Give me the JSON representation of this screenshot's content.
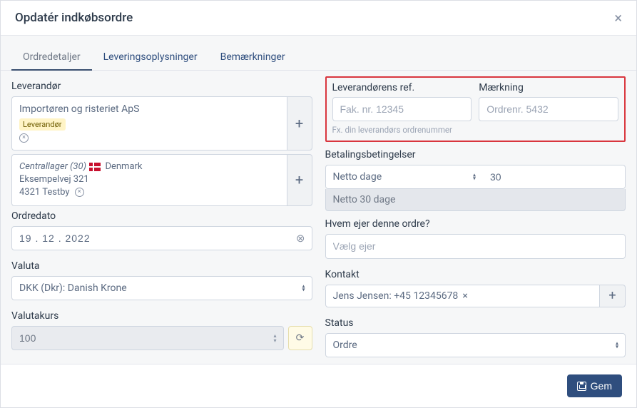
{
  "modal": {
    "title": "Opdatér indkøbsordre",
    "close": "×"
  },
  "tabs": [
    {
      "label": "Ordredetaljer"
    },
    {
      "label": "Leveringsoplysninger"
    },
    {
      "label": "Bemærkninger"
    }
  ],
  "supplier": {
    "label": "Leverandør",
    "name": "Importøren og risteriet ApS",
    "tag": "Leverandør",
    "add": "+"
  },
  "warehouse": {
    "name": "Centrallager (30)",
    "country": "Denmark",
    "line1": "Eksempelvej 321",
    "line2": "4321 Testby",
    "add": "+"
  },
  "order_date": {
    "label": "Ordredato",
    "value": "19 . 12 . 2022"
  },
  "currency": {
    "label": "Valuta",
    "value": "DKK (Dkr): Danish Krone"
  },
  "rate": {
    "label": "Valutakurs",
    "value": "100"
  },
  "supplier_ref": {
    "label": "Leverandørens ref.",
    "placeholder": "Fak. nr. 12345",
    "helper": "Fx. din leverandørs ordrenummer"
  },
  "marking": {
    "label": "Mærkning",
    "placeholder": "Ordrenr. 5432"
  },
  "payment": {
    "label": "Betalingsbetingelser",
    "type": "Netto dage",
    "days": "30",
    "result": "Netto 30 dage"
  },
  "owner": {
    "label": "Hvem ejer denne ordre?",
    "placeholder": "Vælg ejer"
  },
  "contact": {
    "label": "Kontakt",
    "value": "Jens Jensen: +45 12345678",
    "add": "+"
  },
  "status": {
    "label": "Status",
    "value": "Ordre"
  },
  "footer": {
    "save": "Gem"
  }
}
